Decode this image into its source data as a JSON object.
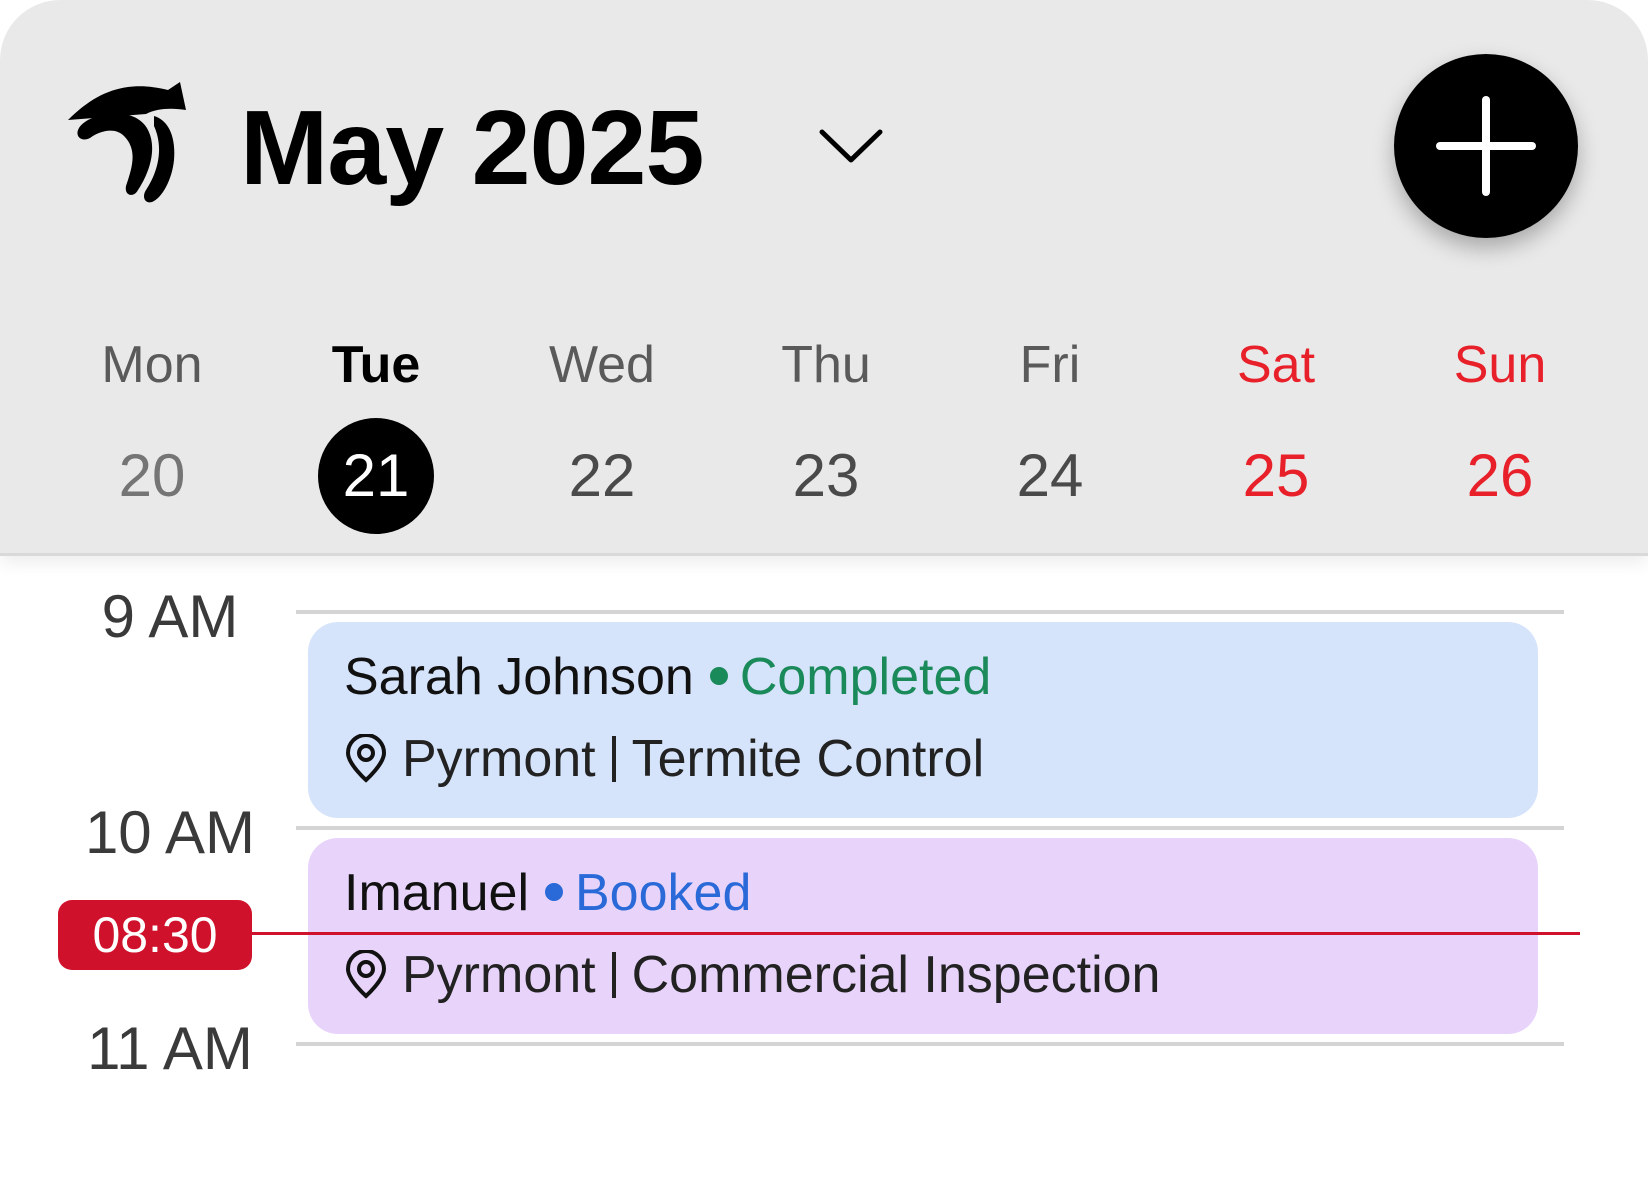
{
  "header": {
    "month_title": "May 2025"
  },
  "week": [
    {
      "name": "Mon",
      "num": "20"
    },
    {
      "name": "Tue",
      "num": "21"
    },
    {
      "name": "Wed",
      "num": "22"
    },
    {
      "name": "Thu",
      "num": "23"
    },
    {
      "name": "Fri",
      "num": "24"
    },
    {
      "name": "Sat",
      "num": "25"
    },
    {
      "name": "Sun",
      "num": "26"
    }
  ],
  "times": [
    "9 AM",
    "10 AM",
    "11 AM"
  ],
  "now_badge": "08:30",
  "events": [
    {
      "name": "Sarah Johnson",
      "status": "Completed",
      "status_color": "#1a8a5a",
      "location": "Pyrmont",
      "service": "Termite Control"
    },
    {
      "name": "Imanuel",
      "status": "Booked",
      "status_color": "#2a6ad8",
      "location": "Pyrmont",
      "service": "Commercial Inspection"
    }
  ],
  "colors": {
    "selected": "#000000",
    "weekend": "#e8202a",
    "now_indicator": "#d0112b"
  }
}
